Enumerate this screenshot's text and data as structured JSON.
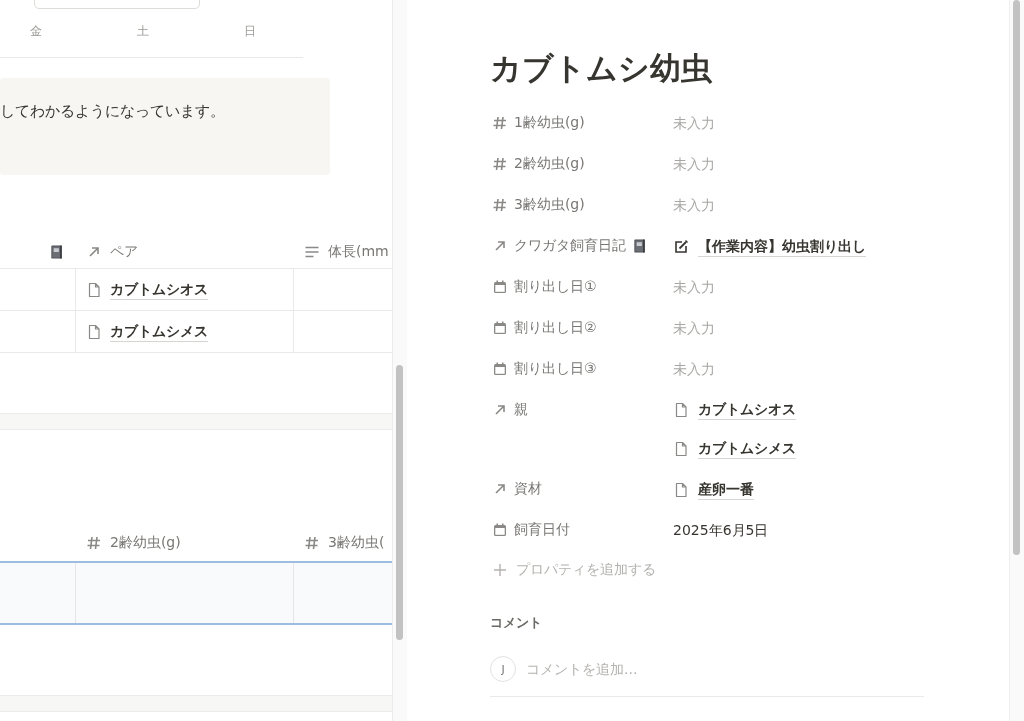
{
  "calendar": {
    "weekdays": [
      "金",
      "土",
      "日"
    ]
  },
  "callout": {
    "text": "してわかるようになっています。"
  },
  "table_1": {
    "columns": [
      {
        "kind": "diary"
      },
      {
        "kind": "relation",
        "label": "ペア"
      },
      {
        "kind": "text",
        "label": "体長(mm"
      }
    ],
    "rows": [
      {
        "cells": [
          "",
          "カブトムシオス",
          ""
        ]
      },
      {
        "cells": [
          "",
          "カブトムシメス",
          ""
        ]
      }
    ]
  },
  "table_2": {
    "columns": [
      {
        "kind": "number",
        "label": "2齢幼虫(g)"
      },
      {
        "kind": "number",
        "label": "3齢幼虫("
      }
    ],
    "rows": [
      {
        "selected": true
      }
    ]
  },
  "page": {
    "title": "カブトムシ幼虫",
    "properties": [
      {
        "kind": "number",
        "label": "1齢幼虫(g)",
        "values": [
          {
            "kind": "empty",
            "text": "未入力"
          }
        ]
      },
      {
        "kind": "number",
        "label": "2齢幼虫(g)",
        "values": [
          {
            "kind": "empty",
            "text": "未入力"
          }
        ]
      },
      {
        "kind": "number",
        "label": "3齢幼虫(g)",
        "values": [
          {
            "kind": "empty",
            "text": "未入力"
          }
        ]
      },
      {
        "kind": "diary",
        "label": "クワガタ飼育日記",
        "values": [
          {
            "kind": "note",
            "text": "【作業内容】幼虫割り出し"
          }
        ]
      },
      {
        "kind": "date",
        "label": "割り出し日①",
        "values": [
          {
            "kind": "empty",
            "text": "未入力"
          }
        ]
      },
      {
        "kind": "date",
        "label": "割り出し日②",
        "values": [
          {
            "kind": "empty",
            "text": "未入力"
          }
        ]
      },
      {
        "kind": "date",
        "label": "割り出し日③",
        "values": [
          {
            "kind": "empty",
            "text": "未入力"
          }
        ]
      },
      {
        "kind": "relation",
        "label": "親",
        "values": [
          {
            "kind": "page",
            "text": "カブトムシオス"
          },
          {
            "kind": "page",
            "text": "カブトムシメス"
          }
        ]
      },
      {
        "kind": "relation",
        "label": "資材",
        "values": [
          {
            "kind": "page",
            "text": "産卵一番"
          }
        ]
      },
      {
        "kind": "date",
        "label": "飼育日付",
        "values": [
          {
            "kind": "date",
            "text": "2025年6月5日"
          }
        ]
      }
    ],
    "add_property": "プロパティを追加する",
    "comments": {
      "heading": "コメント",
      "avatar": "J",
      "placeholder": "コメントを追加..."
    }
  }
}
